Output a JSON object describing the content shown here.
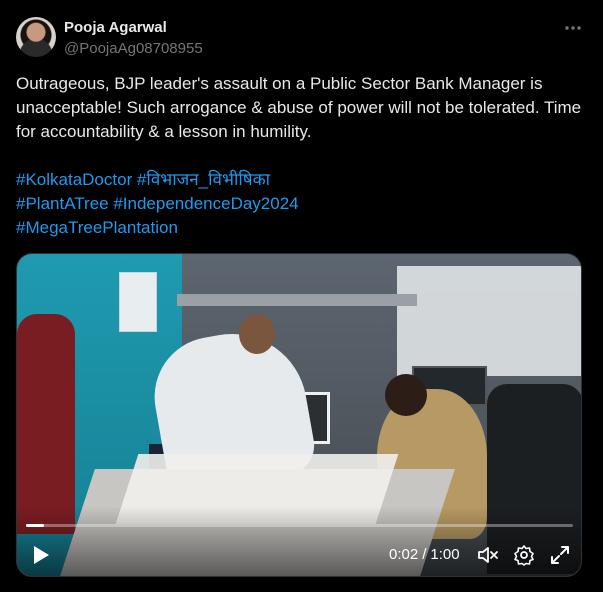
{
  "author": {
    "name": "Pooja Agarwal",
    "handle": "@PoojaAg08708955"
  },
  "post": {
    "text": "Outrageous, BJP leader's assault on a Public Sector Bank Manager is unacceptable! Such arrogance & abuse of power will not be tolerated. Time for accountability & a lesson in humility.",
    "hashtags": [
      "#KolkataDoctor",
      "#विभाजन_विभीषिका",
      "#PlantATree",
      "#IndependenceDay2024",
      "#MegaTreePlantation"
    ]
  },
  "video": {
    "current_time": "0:02",
    "duration": "1:00",
    "progress_fraction": 0.033
  },
  "icons": {
    "more": "more-dots-icon",
    "play": "play-icon",
    "volume": "volume-muted-icon",
    "settings": "gear-icon",
    "fullscreen": "fullscreen-icon"
  },
  "colors": {
    "background": "#000000",
    "text": "#e7e9ea",
    "secondary": "#71767b",
    "link": "#1d9bf0"
  }
}
